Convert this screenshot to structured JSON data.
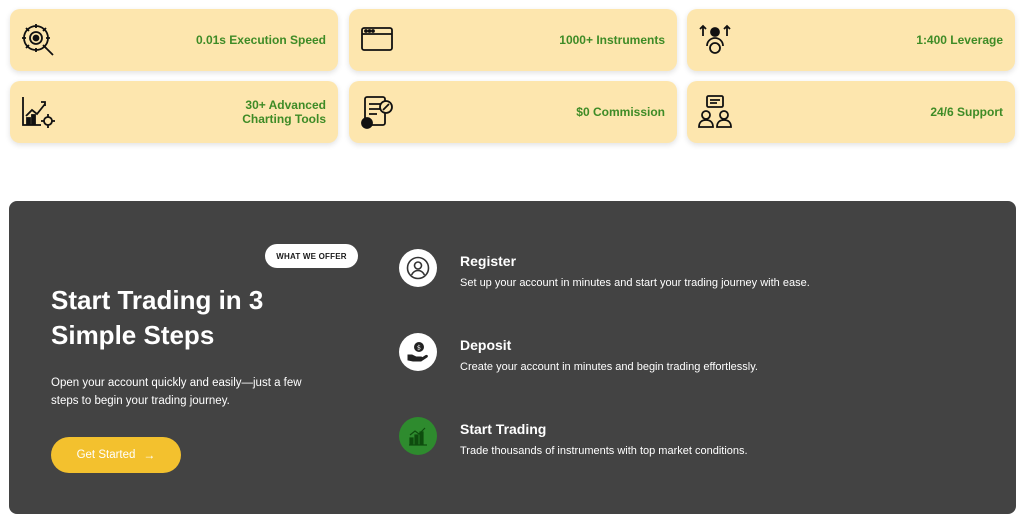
{
  "features": [
    {
      "icon": "gear-speed-icon",
      "label_lines": [
        "0.01s Execution Speed"
      ]
    },
    {
      "icon": "browser-window-icon",
      "label_lines": [
        "1000+ Instruments"
      ]
    },
    {
      "icon": "leverage-person-icon",
      "label_lines": [
        "1:400 Leverage"
      ]
    },
    {
      "icon": "chart-gear-icon",
      "label_lines": [
        "30+ Advanced",
        "Charting Tools"
      ]
    },
    {
      "icon": "document-percent-icon",
      "label_lines": [
        "$0 Commission"
      ]
    },
    {
      "icon": "support-chat-icon",
      "label_lines": [
        "24/6 Support"
      ]
    }
  ],
  "steps_section": {
    "badge": "WHAT WE OFFER",
    "headline_line1": "Start Trading in 3",
    "headline_line2": "Simple Steps",
    "intro_line1": "Open your account quickly and easily—just a few",
    "intro_line2": "steps to begin your trading journey.",
    "cta_label": "Get Started",
    "cta_icon": "arrow-right-icon",
    "steps": [
      {
        "icon": "user-icon",
        "title": "Register",
        "desc": "Set up your account in minutes and start your trading journey with ease."
      },
      {
        "icon": "money-hand-icon",
        "title": "Deposit",
        "desc": "Create your account in minutes and begin trading effortlessly."
      },
      {
        "icon": "bar-chart-icon",
        "title": "Start Trading",
        "desc": "Trade thousands of instruments with top market conditions."
      }
    ]
  },
  "colors": {
    "card_background": "#fde6ae",
    "card_text": "#3e8b26",
    "panel_background": "#434343",
    "cta_background": "#f3c12e",
    "trading_icon_background": "#2e8b2e"
  }
}
